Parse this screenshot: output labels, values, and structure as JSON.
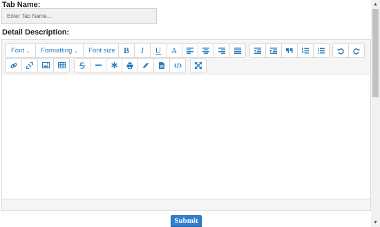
{
  "form": {
    "tab_name_label": "Tab Name:",
    "tab_name_placeholder": "Enter Tab Name...",
    "tab_name_value": "",
    "description_label": "Detail Description:",
    "submit_label": "Submit"
  },
  "toolbar": {
    "dropdowns": [
      "Font",
      "Formatting",
      "Font size"
    ],
    "format_buttons": [
      "B",
      "I",
      "U",
      "A"
    ],
    "dropdown_caret": "⌄"
  },
  "icons": {
    "row1_align": [
      "align-left-icon",
      "align-center-icon",
      "align-right-icon",
      "align-justify-icon"
    ],
    "row1_lists": [
      "outdent-icon",
      "indent-icon",
      "quote-icon",
      "ordered-list-icon",
      "unordered-list-icon"
    ],
    "row1_history": [
      "undo-icon",
      "redo-icon"
    ],
    "row2_insert": [
      "link-icon",
      "unlink-icon",
      "image-icon",
      "table-icon"
    ],
    "row2_misc": [
      "strikethrough-icon",
      "horizontal-rule-icon",
      "special-char-icon"
    ],
    "row2_tools": [
      "print-icon",
      "eraser-icon",
      "document-icon",
      "code-icon"
    ],
    "row2_view": [
      "fullscreen-icon"
    ]
  },
  "colors": {
    "accent": "#2a7cbd",
    "submit_bg": "#2f7fd3",
    "toolbar_bg": "#f5f5f5"
  }
}
